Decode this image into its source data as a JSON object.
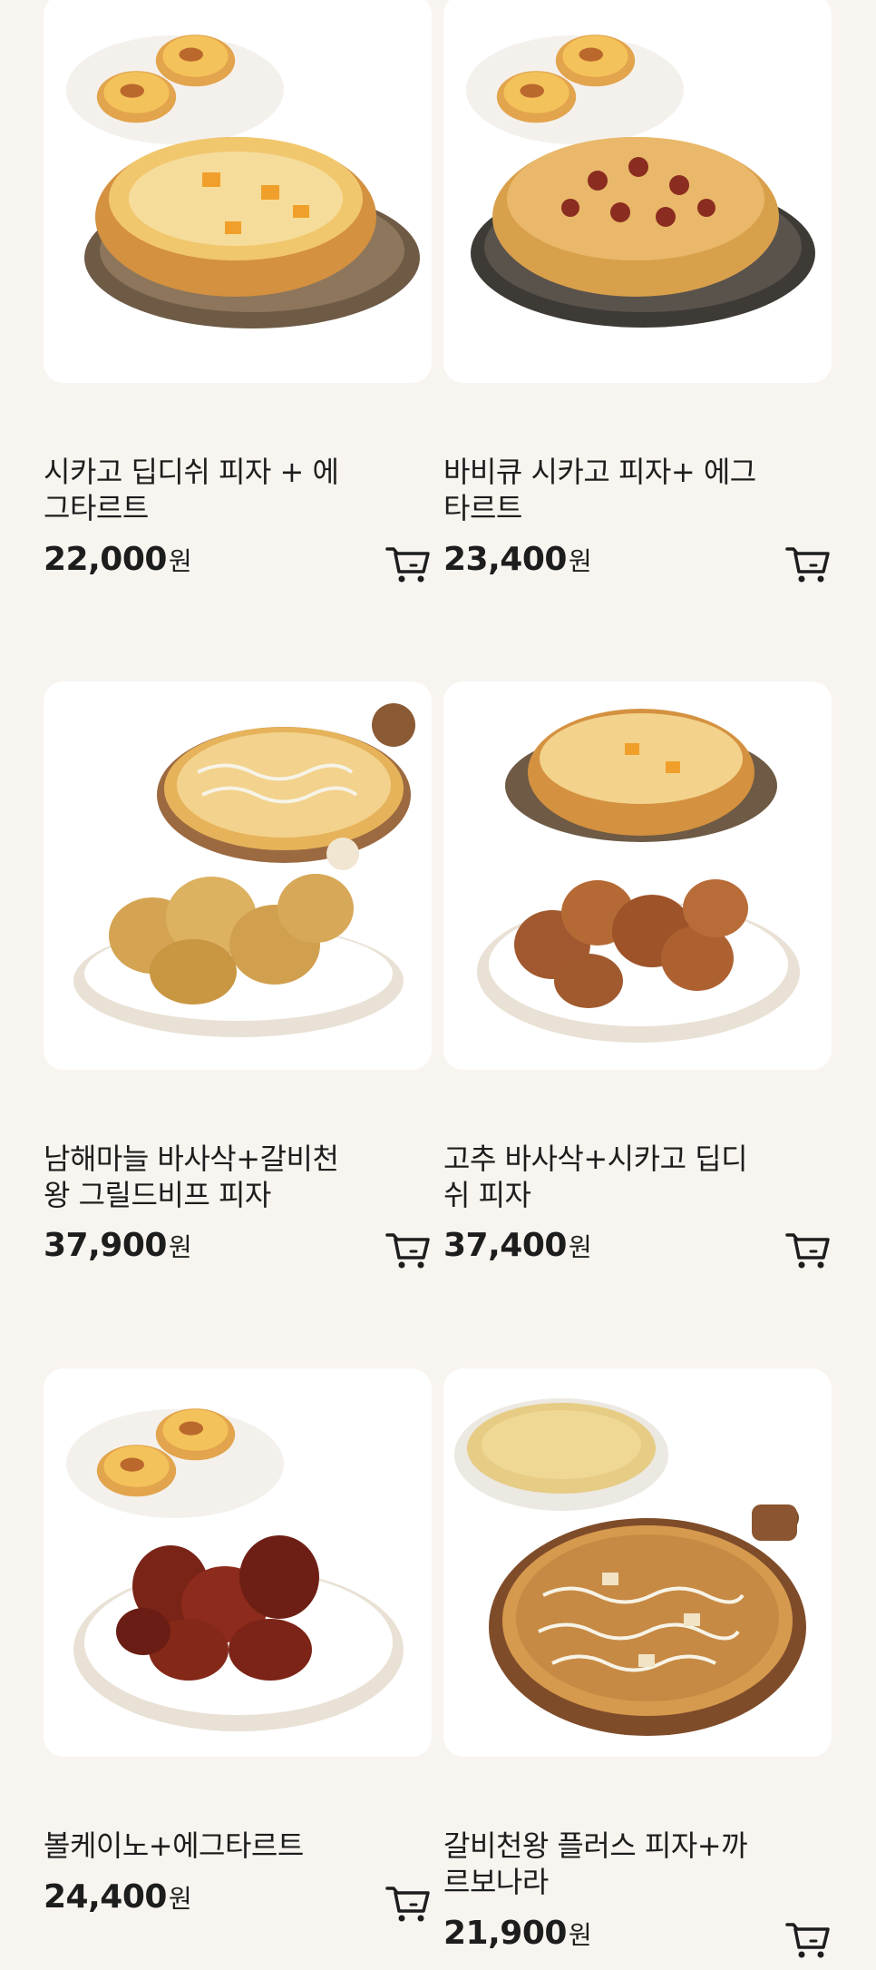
{
  "currency": "원",
  "products": [
    {
      "name": "시카고 딥디쉬 피자 + 에그타르트",
      "price": "22,000",
      "image": "chicago-dish-pizza-egg-tart"
    },
    {
      "name": "바비큐 시카고 피자+ 에그타르트",
      "price": "23,400",
      "image": "bbq-chicago-pizza-egg-tart"
    },
    {
      "name": "남해마늘 바사삭+갈비천왕 그릴드비프 피자",
      "price": "37,900",
      "image": "garlic-chicken-grilled-beef-pizza"
    },
    {
      "name": "고추 바사삭+시카고 딥디쉬 피자",
      "price": "37,400",
      "image": "pepper-chicken-chicago-pizza"
    },
    {
      "name": "볼케이노+에그타르트",
      "price": "24,400",
      "image": "volcano-chicken-egg-tart"
    },
    {
      "name": "갈비천왕 플러스 피자+까르보나라",
      "price": "21,900",
      "image": "galbi-pizza-carbonara"
    }
  ],
  "icons": {
    "cart": "shopping-cart-icon"
  },
  "colors": {
    "background": "#f8f4ef",
    "card": "#ffffff",
    "text": "#1d1d1d"
  }
}
